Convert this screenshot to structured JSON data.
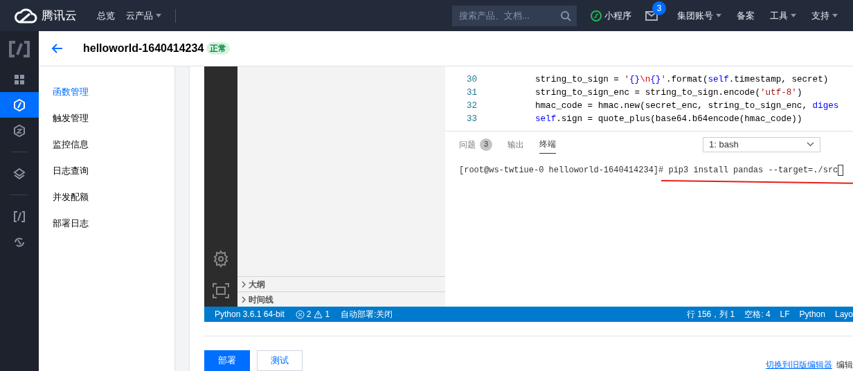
{
  "topbar": {
    "brand": "腾讯云",
    "nav": [
      {
        "label": "总览",
        "dropdown": false
      },
      {
        "label": "云产品",
        "dropdown": true
      }
    ],
    "search": {
      "placeholder": "搜索产品、文档..."
    },
    "mini_program": "小程序",
    "mail_badge": "3",
    "menus": [
      {
        "label": "集团账号",
        "dropdown": true
      },
      {
        "label": "备案",
        "dropdown": false
      },
      {
        "label": "工具",
        "dropdown": true
      },
      {
        "label": "支持",
        "dropdown": true
      }
    ]
  },
  "rail": [
    {
      "selected": false
    },
    {
      "selected": true
    },
    {
      "selected": false
    },
    {
      "selected": false
    },
    {
      "selected": false
    },
    {
      "selected": false
    }
  ],
  "header": {
    "title": "helloworld-1640414234",
    "status": "正常"
  },
  "sidebar": [
    {
      "label": "函数管理",
      "selected": true
    },
    {
      "label": "触发管理",
      "selected": false
    },
    {
      "label": "监控信息",
      "selected": false
    },
    {
      "label": "日志查询",
      "selected": false
    },
    {
      "label": "并发配额",
      "selected": false
    },
    {
      "label": "部署日志",
      "selected": false
    }
  ],
  "explorer_sections": [
    "大纲",
    "时间线"
  ],
  "code": [
    {
      "line": "30",
      "tokens": [
        {
          "t": "string_to_sign = ",
          "kind": "plain"
        },
        {
          "t": "'",
          "kind": "str"
        },
        {
          "t": "{}",
          "kind": "kw"
        },
        {
          "t": "\\n",
          "kind": "esc"
        },
        {
          "t": "{}",
          "kind": "kw"
        },
        {
          "t": "'",
          "kind": "str"
        },
        {
          "t": ".format(",
          "kind": "plain"
        },
        {
          "t": "self",
          "kind": "kw"
        },
        {
          "t": ".timestamp, secret)",
          "kind": "plain"
        }
      ]
    },
    {
      "line": "31",
      "tokens": [
        {
          "t": "string_to_sign_enc = string_to_sign.encode(",
          "kind": "plain"
        },
        {
          "t": "'utf-8'",
          "kind": "str"
        },
        {
          "t": ")",
          "kind": "plain"
        }
      ]
    },
    {
      "line": "32",
      "tokens": [
        {
          "t": "hmac_code = hmac.new(secret_enc, string_to_sign_enc, ",
          "kind": "plain"
        },
        {
          "t": "diges",
          "kind": "kw"
        }
      ]
    },
    {
      "line": "33",
      "tokens": [
        {
          "t": "self",
          "kind": "kw"
        },
        {
          "t": ".sign = quote_plus(base64.b64encode(hmac_code))",
          "kind": "plain"
        }
      ]
    }
  ],
  "panel": {
    "tabs": [
      {
        "label": "问题",
        "count": "3",
        "selected": false
      },
      {
        "label": "输出",
        "selected": false
      },
      {
        "label": "终端",
        "selected": true
      }
    ],
    "terminal_select": "1: bash",
    "terminal_line": "[root@ws-twtiue-0 helloworld-1640414234]# pip3 install pandas --target=./src"
  },
  "status_bar": {
    "left": [
      "Python 3.6.1 64-bit"
    ],
    "errors": "2",
    "warnings": "1",
    "auto_deploy": "自动部署:关闭",
    "right": [
      "行 156，列 1",
      "空格: 4",
      "LF",
      "Python",
      "Layo"
    ]
  },
  "buttons": [
    {
      "label": "部署",
      "primary": true
    },
    {
      "label": "测试",
      "primary": false
    }
  ],
  "footer_links": [
    "切换到旧版编辑器",
    "编辑"
  ]
}
